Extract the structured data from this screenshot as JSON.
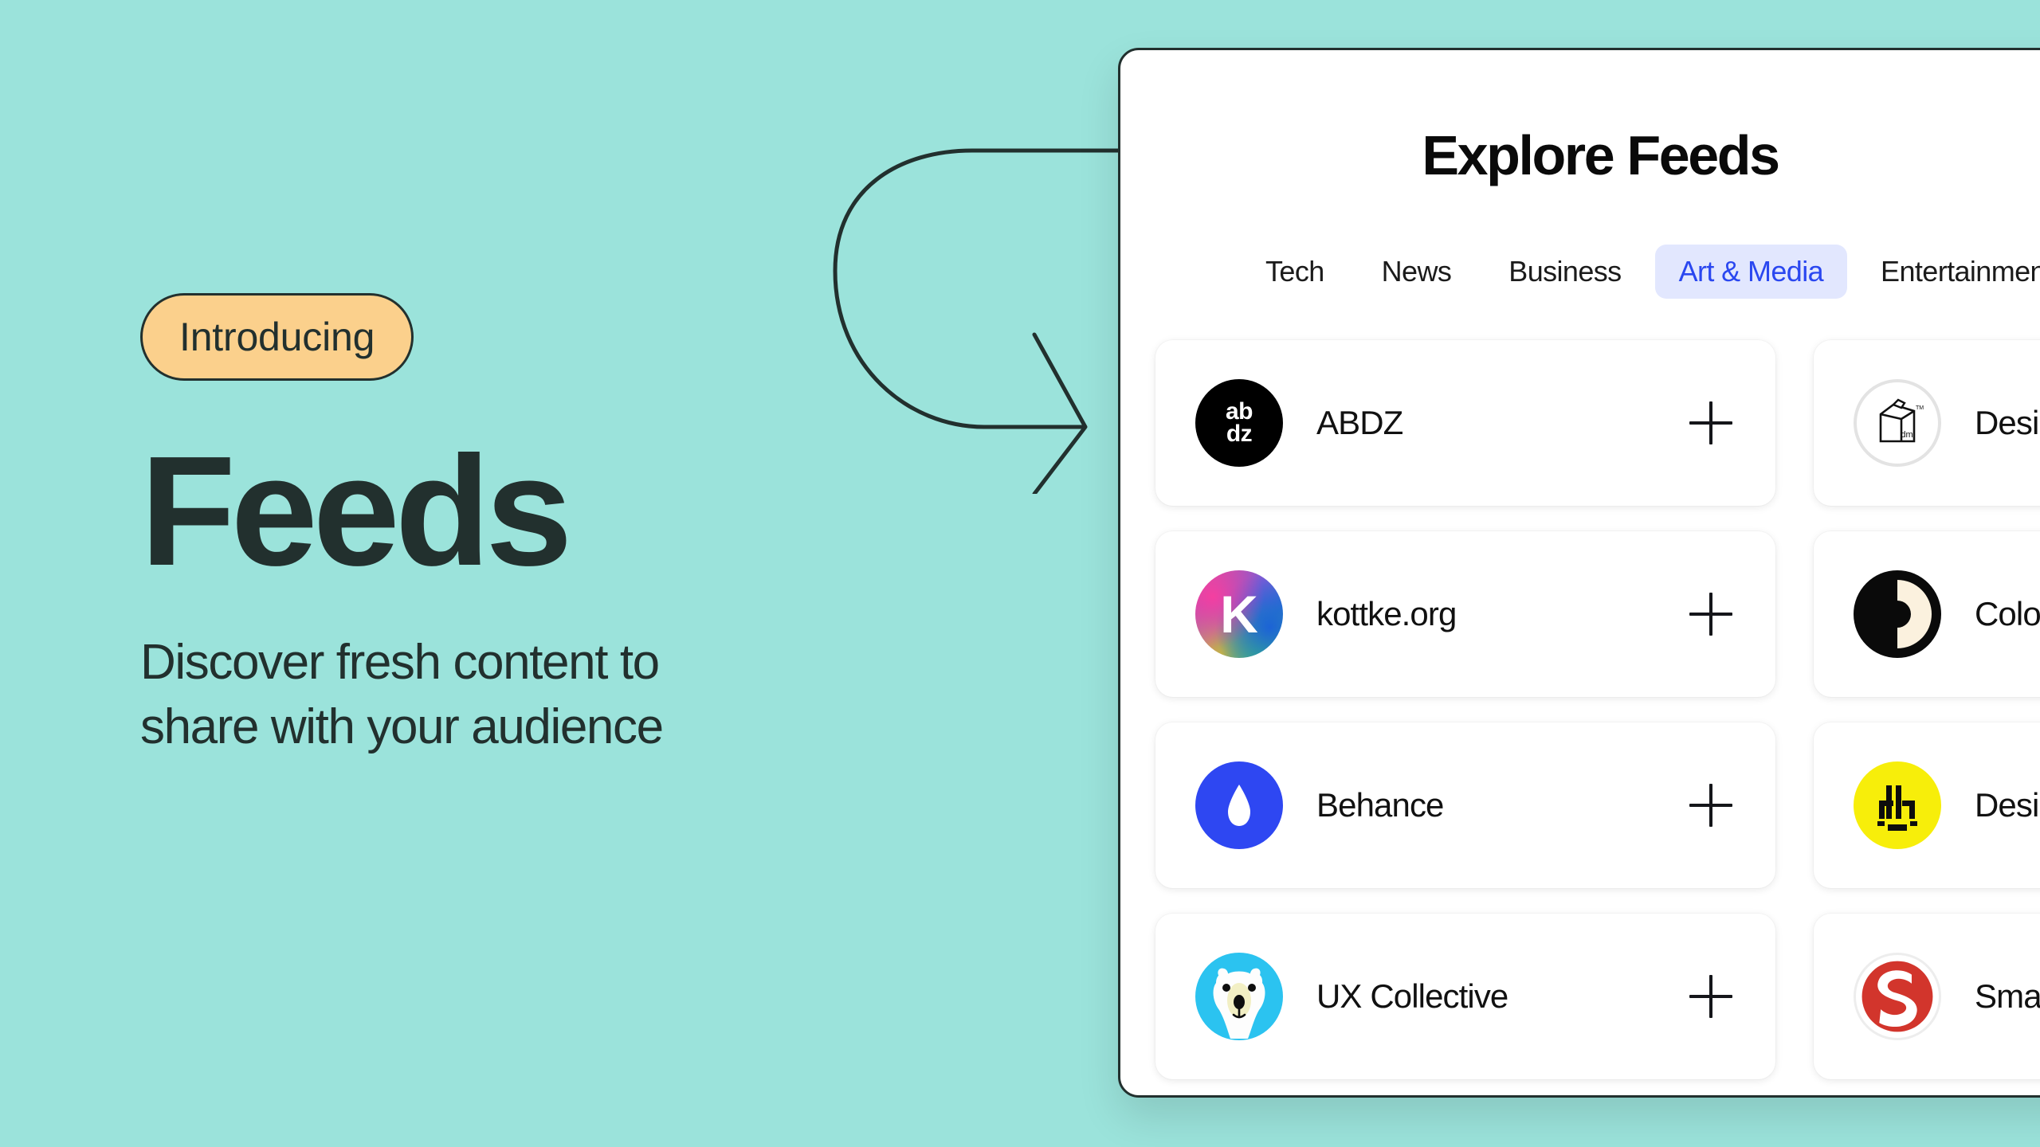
{
  "theme": {
    "background": "#9BE3DB",
    "ink": "#22302E",
    "badge_bg": "#FBD08C",
    "accent_blue": "#2A47F0",
    "tab_active_bg": "#E2E7FE"
  },
  "hero": {
    "badge_label": "Introducing",
    "title": "Feeds",
    "subtitle_line1": "Discover fresh content to",
    "subtitle_line2": "share with your audience"
  },
  "panel": {
    "title": "Explore Feeds",
    "tabs": [
      {
        "label": "Tech",
        "active": false
      },
      {
        "label": "News",
        "active": false
      },
      {
        "label": "Business",
        "active": false
      },
      {
        "label": "Art & Media",
        "active": true
      },
      {
        "label": "Entertainment",
        "active": false
      }
    ],
    "feeds": [
      {
        "name": "ABDZ",
        "logo": "abdz-logo",
        "logo_text": "ab\ndz",
        "action": "+"
      },
      {
        "name": "Design Milk",
        "logo": "design-milk-logo",
        "logo_text": "dm",
        "action": "+"
      },
      {
        "name": "kottke.org",
        "logo": "kottke-logo",
        "logo_text": "K",
        "action": "+"
      },
      {
        "name": "Colossal",
        "logo": "colossal-logo",
        "logo_text": "C",
        "action": "+"
      },
      {
        "name": "Behance",
        "logo": "behance-logo",
        "logo_text": "",
        "action": "+"
      },
      {
        "name": "Design Boom",
        "logo": "designboom-logo",
        "logo_text": "db",
        "action": "+"
      },
      {
        "name": "UX Collective",
        "logo": "ux-collective-logo",
        "logo_text": "",
        "action": "+"
      },
      {
        "name": "Smashing Magazine",
        "logo": "smashing-logo",
        "logo_text": "S",
        "action": "+"
      }
    ]
  }
}
